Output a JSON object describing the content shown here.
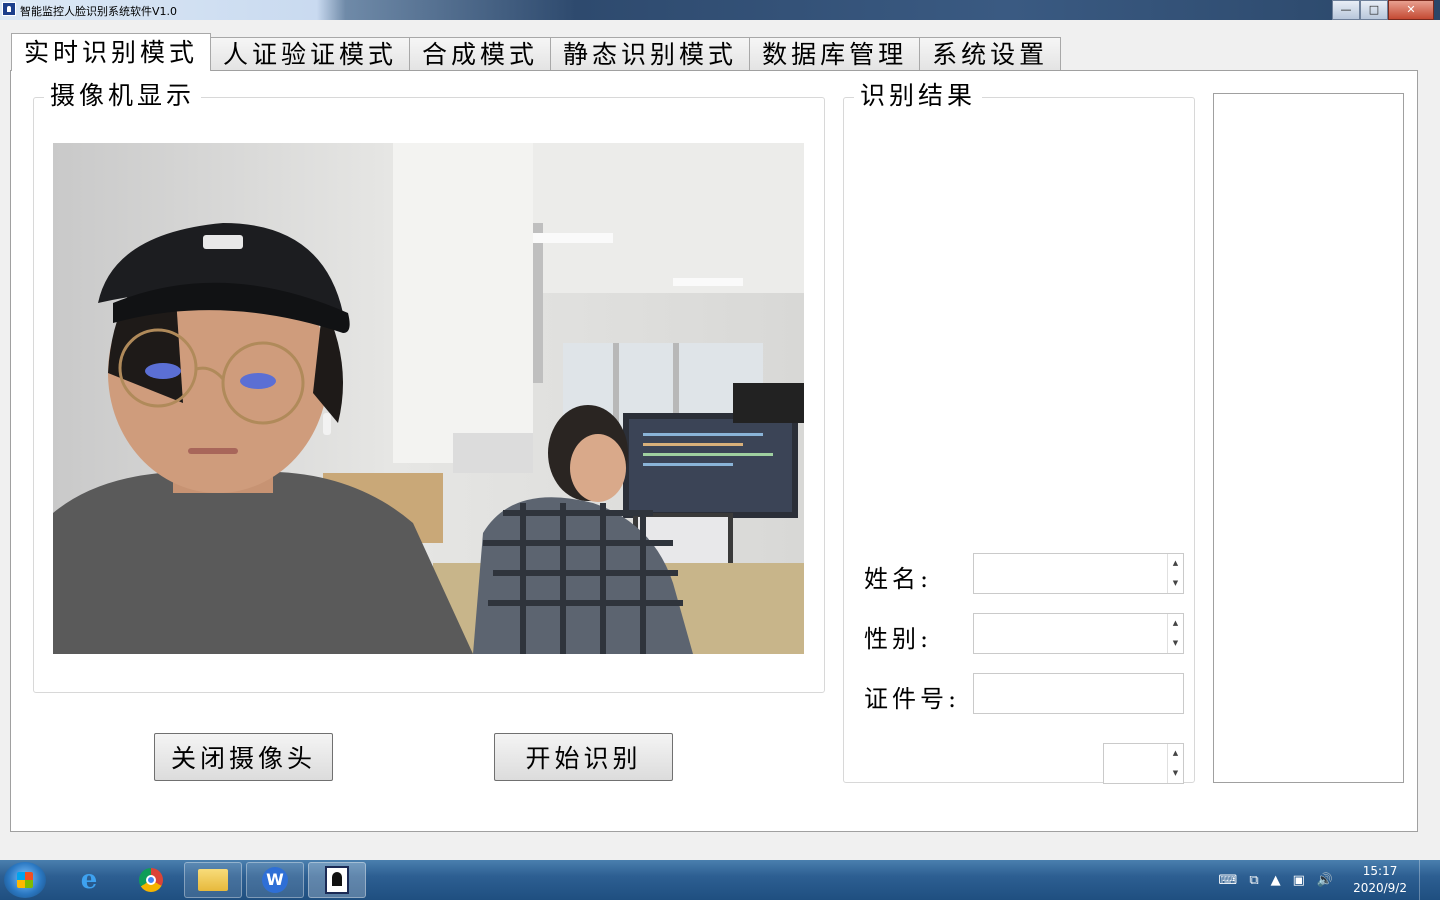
{
  "window": {
    "title": "智能监控人脸识别系统软件V1.0",
    "min_glyph": "—",
    "max_glyph": "□",
    "close_glyph": "✕"
  },
  "tabs": [
    {
      "label": "实时识别模式",
      "active": true
    },
    {
      "label": "人证验证模式",
      "active": false
    },
    {
      "label": "合成模式",
      "active": false
    },
    {
      "label": "静态识别模式",
      "active": false
    },
    {
      "label": "数据库管理",
      "active": false
    },
    {
      "label": "系统设置",
      "active": false
    }
  ],
  "camera_group": {
    "title": "摄像机显示"
  },
  "result_group": {
    "title": "识别结果",
    "name_label": "姓名:",
    "gender_label": "性别:",
    "id_label": "证件号:"
  },
  "buttons": {
    "close_camera": "关闭摄像头",
    "start_recognition": "开始识别"
  },
  "taskbar": {
    "time": "15:17",
    "date": "2020/9/2"
  },
  "colors": {
    "panel_bg": "#ffffff",
    "window_bg": "#f0f0f0",
    "taskbar": "#2d5f92"
  }
}
